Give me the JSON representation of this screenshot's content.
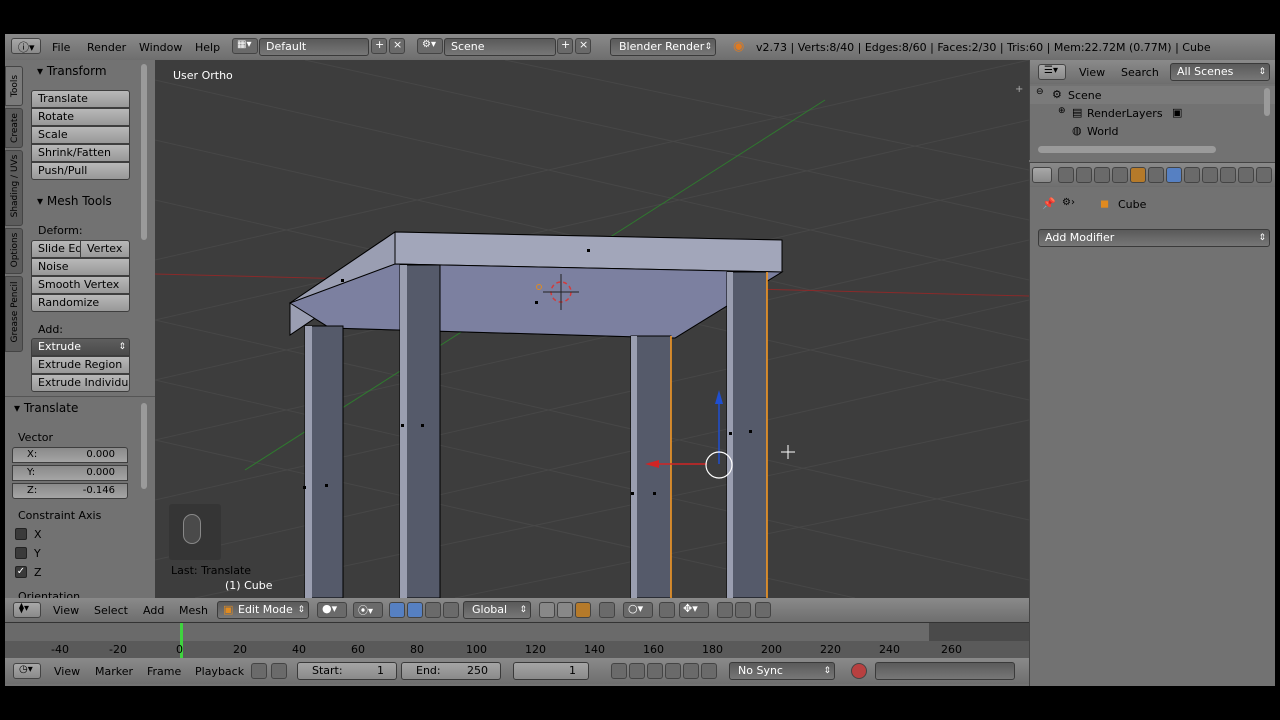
{
  "info_header": {
    "menus": [
      "File",
      "Render",
      "Window",
      "Help"
    ],
    "screen_layout": "Default",
    "scene": "Scene",
    "render_engine": "Blender Render",
    "stats": "v2.73 | Verts:8/40 | Edges:8/60 | Faces:2/30 | Tris:60 | Mem:22.72M (0.77M) | Cube"
  },
  "tool_tabs": [
    "Tools",
    "Create",
    "Shading / UVs",
    "Options",
    "Grease Pencil"
  ],
  "tools": {
    "transform_title": "Transform",
    "transform_buttons": [
      "Translate",
      "Rotate",
      "Scale",
      "Shrink/Fatten",
      "Push/Pull"
    ],
    "mesh_tools_title": "Mesh Tools",
    "deform_label": "Deform:",
    "slide_edge": "Slide Ed",
    "vertex": "Vertex",
    "deform_buttons": [
      "Noise",
      "Smooth Vertex",
      "Randomize"
    ],
    "add_label": "Add:",
    "extrude": "Extrude",
    "add_buttons": [
      "Extrude Region",
      "Extrude Individual"
    ]
  },
  "operator": {
    "title": "Translate",
    "vector_label": "Vector",
    "x_label": "X:",
    "x_value": "0.000",
    "y_label": "Y:",
    "y_value": "0.000",
    "z_label": "Z:",
    "z_value": "-0.146",
    "constraint_label": "Constraint Axis",
    "axes": [
      {
        "name": "X",
        "checked": false
      },
      {
        "name": "Y",
        "checked": false
      },
      {
        "name": "Z",
        "checked": true
      }
    ],
    "orientation_label": "Orientation"
  },
  "viewport": {
    "view_name": "User Ortho",
    "last_op": "Last: Translate",
    "object_label": "(1) Cube"
  },
  "view3d_header": {
    "menus": [
      "View",
      "Select",
      "Add",
      "Mesh"
    ],
    "mode": "Edit Mode",
    "orientation": "Global"
  },
  "timeline": {
    "ruler": [
      "-40",
      "-20",
      "0",
      "20",
      "40",
      "60",
      "80",
      "100",
      "120",
      "140",
      "160",
      "180",
      "200",
      "220",
      "240",
      "260"
    ],
    "menus": [
      "View",
      "Marker",
      "Frame",
      "Playback"
    ],
    "start_label": "Start:",
    "start_value": "1",
    "end_label": "End:",
    "end_value": "250",
    "current_frame": "1",
    "sync": "No Sync"
  },
  "outliner": {
    "menus": [
      "View",
      "Search"
    ],
    "filter": "All Scenes",
    "items": [
      "Scene",
      "RenderLayers",
      "World"
    ]
  },
  "properties": {
    "object_name": "Cube",
    "add_modifier": "Add Modifier"
  },
  "colors": {
    "accent": "#5680c2",
    "selected_edge": "#ff9b1f",
    "x_axis": "#d12424",
    "y_axis": "#3fa63f",
    "z_axis": "#1f4fd1"
  }
}
